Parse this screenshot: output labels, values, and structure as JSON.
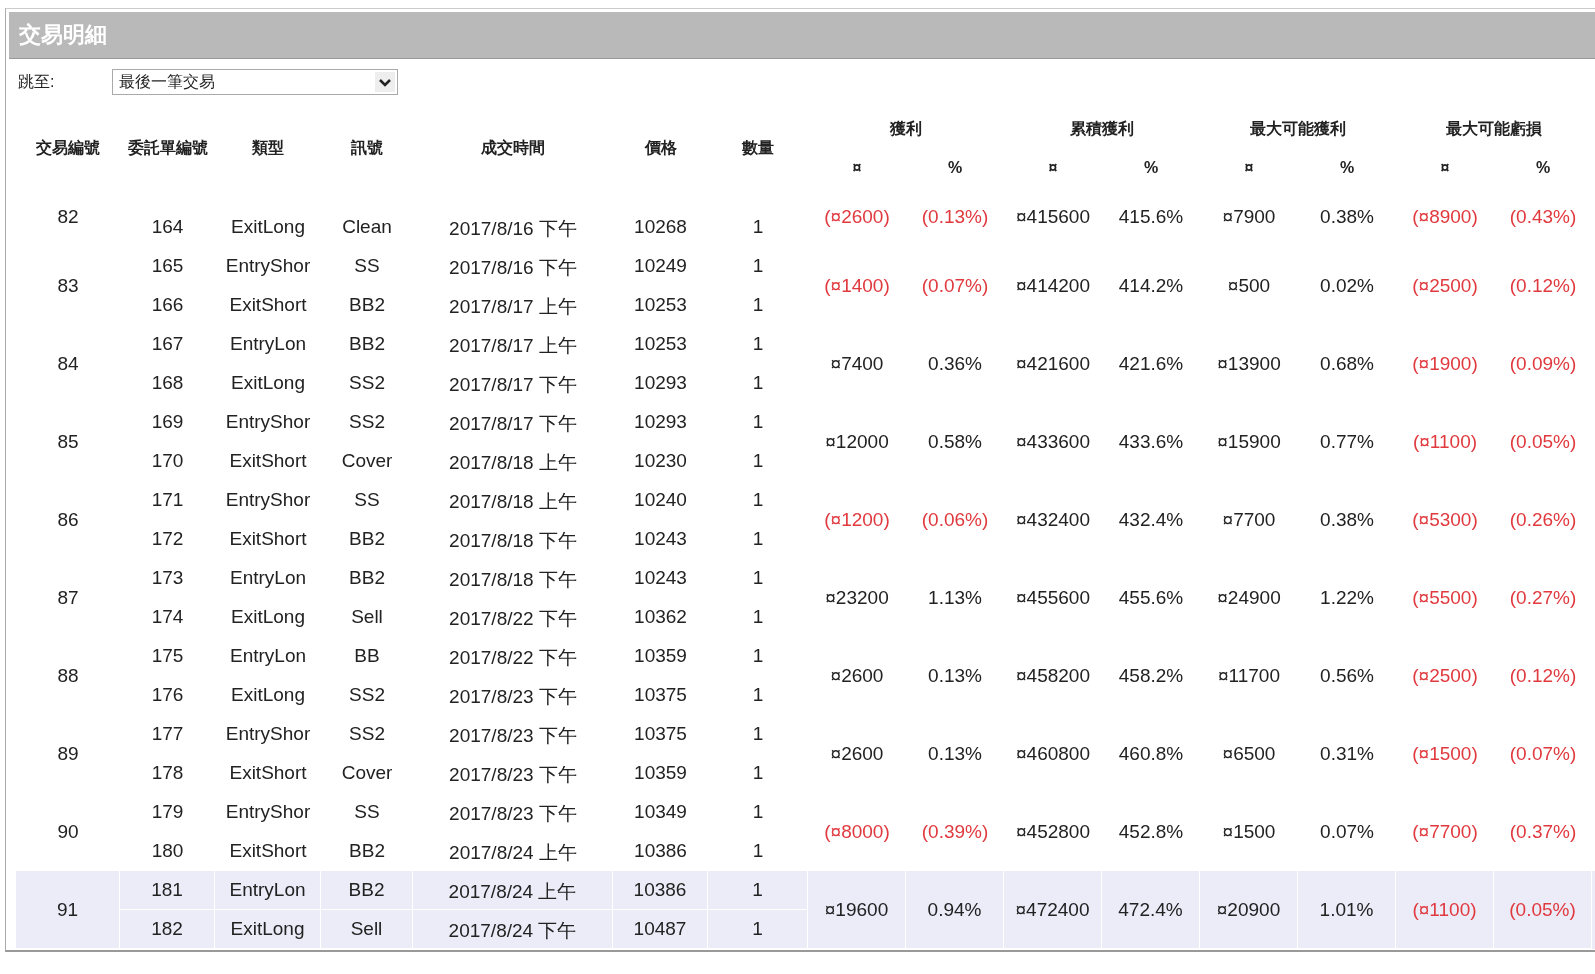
{
  "panel": {
    "title": "交易明細"
  },
  "jump": {
    "label": "跳至:",
    "value": "最後一筆交易"
  },
  "columns": {
    "trade": "交易編號",
    "order": "委託單編號",
    "type": "類型",
    "signal": "訊號",
    "time": "成交時間",
    "price": "價格",
    "qty": "數量"
  },
  "metric_groups": [
    {
      "title": "獲利",
      "amount_header": "¤",
      "percent_header": "%"
    },
    {
      "title": "累積獲利",
      "amount_header": "¤",
      "percent_header": "%"
    },
    {
      "title": "最大可能獲利",
      "amount_header": "¤",
      "percent_header": "%"
    },
    {
      "title": "最大可能虧損",
      "amount_header": "¤",
      "percent_header": "%"
    }
  ],
  "trades": [
    {
      "number": "82",
      "selected": false,
      "orders": [
        {
          "order": "164",
          "type": "ExitLong",
          "signal": "Clean",
          "time": "2017/8/16 下午",
          "price": "10268",
          "qty": "1"
        }
      ],
      "metrics": [
        {
          "amount": "(¤2600)",
          "percent": "(0.13%)",
          "negative": true
        },
        {
          "amount": "¤415600",
          "percent": "415.6%",
          "negative": false
        },
        {
          "amount": "¤7900",
          "percent": "0.38%",
          "negative": false
        },
        {
          "amount": "(¤8900)",
          "percent": "(0.43%)",
          "negative": true
        }
      ]
    },
    {
      "number": "83",
      "selected": false,
      "orders": [
        {
          "order": "165",
          "type": "EntryShor",
          "signal": "SS",
          "time": "2017/8/16 下午",
          "price": "10249",
          "qty": "1"
        },
        {
          "order": "166",
          "type": "ExitShort",
          "signal": "BB2",
          "time": "2017/8/17 上午",
          "price": "10253",
          "qty": "1"
        }
      ],
      "metrics": [
        {
          "amount": "(¤1400)",
          "percent": "(0.07%)",
          "negative": true
        },
        {
          "amount": "¤414200",
          "percent": "414.2%",
          "negative": false
        },
        {
          "amount": "¤500",
          "percent": "0.02%",
          "negative": false
        },
        {
          "amount": "(¤2500)",
          "percent": "(0.12%)",
          "negative": true
        }
      ]
    },
    {
      "number": "84",
      "selected": false,
      "orders": [
        {
          "order": "167",
          "type": "EntryLon",
          "signal": "BB2",
          "time": "2017/8/17 上午",
          "price": "10253",
          "qty": "1"
        },
        {
          "order": "168",
          "type": "ExitLong",
          "signal": "SS2",
          "time": "2017/8/17 下午",
          "price": "10293",
          "qty": "1"
        }
      ],
      "metrics": [
        {
          "amount": "¤7400",
          "percent": "0.36%",
          "negative": false
        },
        {
          "amount": "¤421600",
          "percent": "421.6%",
          "negative": false
        },
        {
          "amount": "¤13900",
          "percent": "0.68%",
          "negative": false
        },
        {
          "amount": "(¤1900)",
          "percent": "(0.09%)",
          "negative": true
        }
      ]
    },
    {
      "number": "85",
      "selected": false,
      "orders": [
        {
          "order": "169",
          "type": "EntryShor",
          "signal": "SS2",
          "time": "2017/8/17 下午",
          "price": "10293",
          "qty": "1"
        },
        {
          "order": "170",
          "type": "ExitShort",
          "signal": "Cover",
          "time": "2017/8/18 上午",
          "price": "10230",
          "qty": "1"
        }
      ],
      "metrics": [
        {
          "amount": "¤12000",
          "percent": "0.58%",
          "negative": false
        },
        {
          "amount": "¤433600",
          "percent": "433.6%",
          "negative": false
        },
        {
          "amount": "¤15900",
          "percent": "0.77%",
          "negative": false
        },
        {
          "amount": "(¤1100)",
          "percent": "(0.05%)",
          "negative": true
        }
      ]
    },
    {
      "number": "86",
      "selected": false,
      "orders": [
        {
          "order": "171",
          "type": "EntryShor",
          "signal": "SS",
          "time": "2017/8/18 上午",
          "price": "10240",
          "qty": "1"
        },
        {
          "order": "172",
          "type": "ExitShort",
          "signal": "BB2",
          "time": "2017/8/18 下午",
          "price": "10243",
          "qty": "1"
        }
      ],
      "metrics": [
        {
          "amount": "(¤1200)",
          "percent": "(0.06%)",
          "negative": true
        },
        {
          "amount": "¤432400",
          "percent": "432.4%",
          "negative": false
        },
        {
          "amount": "¤7700",
          "percent": "0.38%",
          "negative": false
        },
        {
          "amount": "(¤5300)",
          "percent": "(0.26%)",
          "negative": true
        }
      ]
    },
    {
      "number": "87",
      "selected": false,
      "orders": [
        {
          "order": "173",
          "type": "EntryLon",
          "signal": "BB2",
          "time": "2017/8/18 下午",
          "price": "10243",
          "qty": "1"
        },
        {
          "order": "174",
          "type": "ExitLong",
          "signal": "Sell",
          "time": "2017/8/22 下午",
          "price": "10362",
          "qty": "1"
        }
      ],
      "metrics": [
        {
          "amount": "¤23200",
          "percent": "1.13%",
          "negative": false
        },
        {
          "amount": "¤455600",
          "percent": "455.6%",
          "negative": false
        },
        {
          "amount": "¤24900",
          "percent": "1.22%",
          "negative": false
        },
        {
          "amount": "(¤5500)",
          "percent": "(0.27%)",
          "negative": true
        }
      ]
    },
    {
      "number": "88",
      "selected": false,
      "orders": [
        {
          "order": "175",
          "type": "EntryLon",
          "signal": "BB",
          "time": "2017/8/22 下午",
          "price": "10359",
          "qty": "1"
        },
        {
          "order": "176",
          "type": "ExitLong",
          "signal": "SS2",
          "time": "2017/8/23 下午",
          "price": "10375",
          "qty": "1"
        }
      ],
      "metrics": [
        {
          "amount": "¤2600",
          "percent": "0.13%",
          "negative": false
        },
        {
          "amount": "¤458200",
          "percent": "458.2%",
          "negative": false
        },
        {
          "amount": "¤11700",
          "percent": "0.56%",
          "negative": false
        },
        {
          "amount": "(¤2500)",
          "percent": "(0.12%)",
          "negative": true
        }
      ]
    },
    {
      "number": "89",
      "selected": false,
      "orders": [
        {
          "order": "177",
          "type": "EntryShor",
          "signal": "SS2",
          "time": "2017/8/23 下午",
          "price": "10375",
          "qty": "1"
        },
        {
          "order": "178",
          "type": "ExitShort",
          "signal": "Cover",
          "time": "2017/8/23 下午",
          "price": "10359",
          "qty": "1"
        }
      ],
      "metrics": [
        {
          "amount": "¤2600",
          "percent": "0.13%",
          "negative": false
        },
        {
          "amount": "¤460800",
          "percent": "460.8%",
          "negative": false
        },
        {
          "amount": "¤6500",
          "percent": "0.31%",
          "negative": false
        },
        {
          "amount": "(¤1500)",
          "percent": "(0.07%)",
          "negative": true
        }
      ]
    },
    {
      "number": "90",
      "selected": false,
      "orders": [
        {
          "order": "179",
          "type": "EntryShor",
          "signal": "SS",
          "time": "2017/8/23 下午",
          "price": "10349",
          "qty": "1"
        },
        {
          "order": "180",
          "type": "ExitShort",
          "signal": "BB2",
          "time": "2017/8/24 上午",
          "price": "10386",
          "qty": "1"
        }
      ],
      "metrics": [
        {
          "amount": "(¤8000)",
          "percent": "(0.39%)",
          "negative": true
        },
        {
          "amount": "¤452800",
          "percent": "452.8%",
          "negative": false
        },
        {
          "amount": "¤1500",
          "percent": "0.07%",
          "negative": false
        },
        {
          "amount": "(¤7700)",
          "percent": "(0.37%)",
          "negative": true
        }
      ]
    },
    {
      "number": "91",
      "selected": true,
      "orders": [
        {
          "order": "181",
          "type": "EntryLon",
          "signal": "BB2",
          "time": "2017/8/24 上午",
          "price": "10386",
          "qty": "1"
        },
        {
          "order": "182",
          "type": "ExitLong",
          "signal": "Sell",
          "time": "2017/8/24 下午",
          "price": "10487",
          "qty": "1"
        }
      ],
      "metrics": [
        {
          "amount": "¤19600",
          "percent": "0.94%",
          "negative": false
        },
        {
          "amount": "¤472400",
          "percent": "472.4%",
          "negative": false
        },
        {
          "amount": "¤20900",
          "percent": "1.01%",
          "negative": false
        },
        {
          "amount": "(¤1100)",
          "percent": "(0.05%)",
          "negative": true
        }
      ]
    }
  ]
}
